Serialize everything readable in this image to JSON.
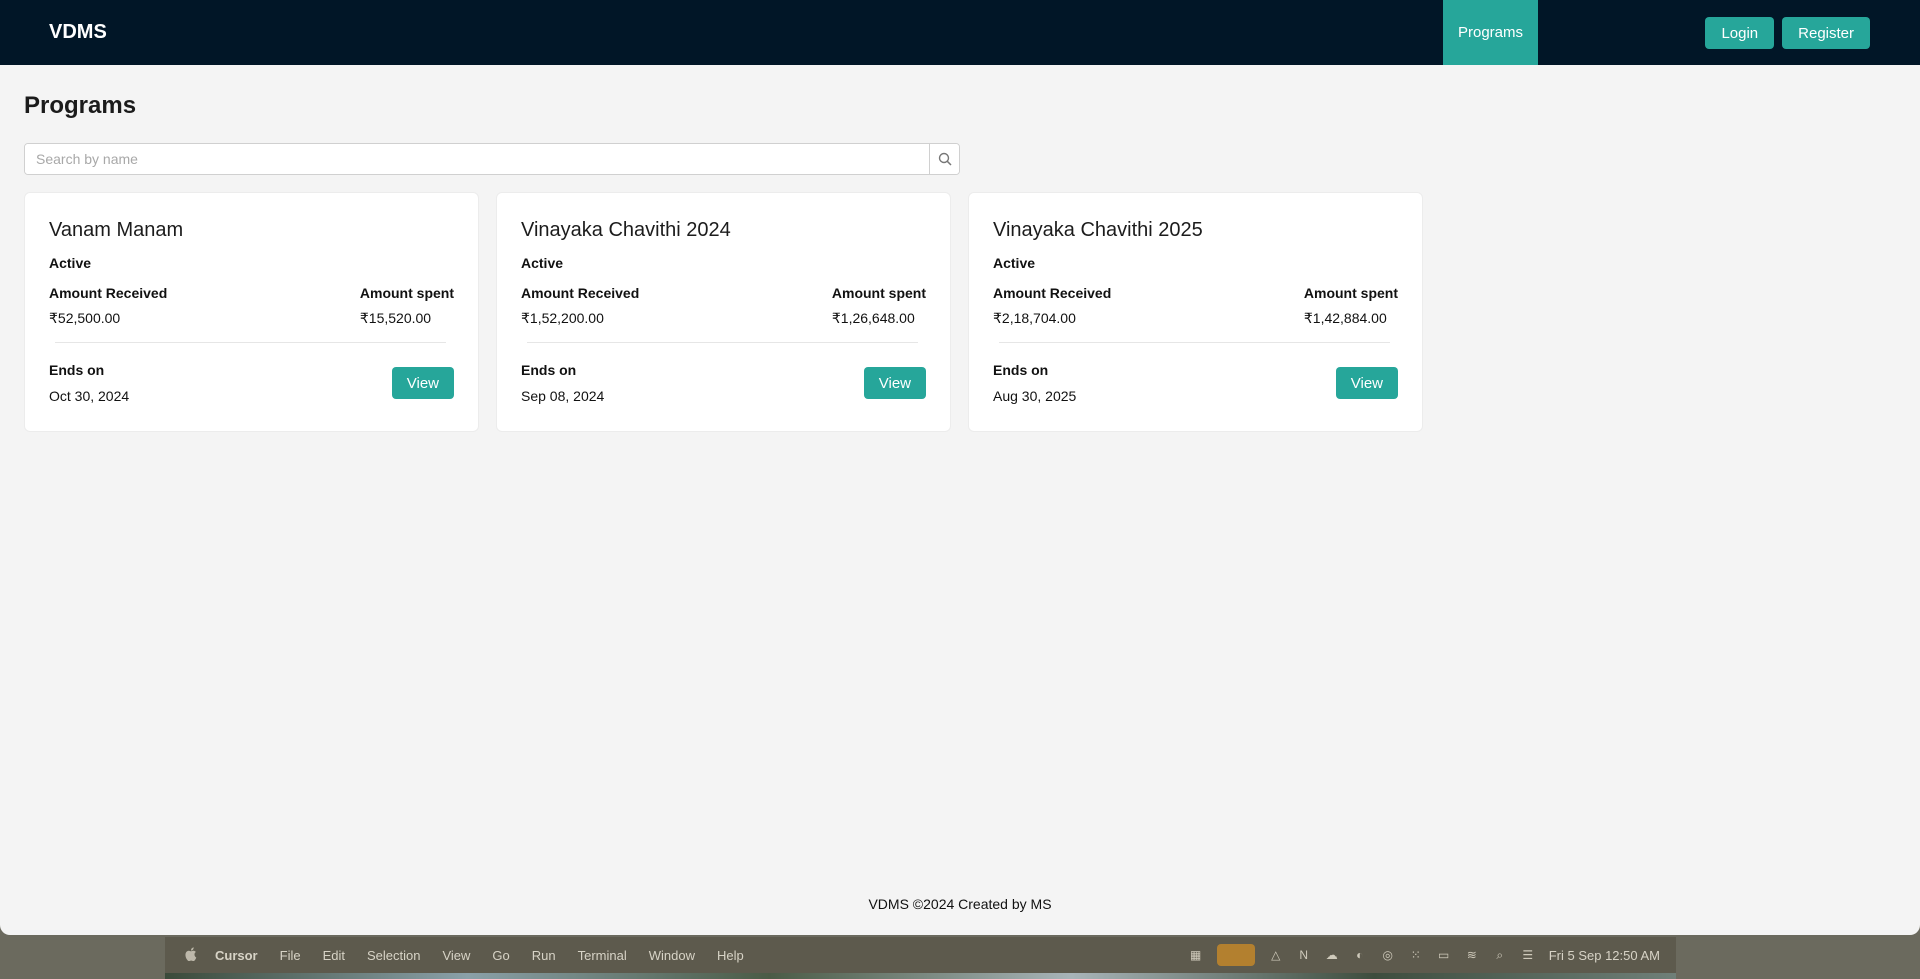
{
  "navbar": {
    "brand": "VDMS",
    "tab_programs": "Programs",
    "login_label": "Login",
    "register_label": "Register"
  },
  "page": {
    "title": "Programs",
    "search_placeholder": "Search by name"
  },
  "cards": [
    {
      "title": "Vanam Manam",
      "status": "Active",
      "received_label": "Amount Received",
      "received_value": "₹52,500.00",
      "spent_label": "Amount spent",
      "spent_value": "₹15,520.00",
      "ends_label": "Ends on",
      "ends_value": "Oct 30, 2024",
      "view_label": "View"
    },
    {
      "title": "Vinayaka Chavithi 2024",
      "status": "Active",
      "received_label": "Amount Received",
      "received_value": "₹1,52,200.00",
      "spent_label": "Amount spent",
      "spent_value": "₹1,26,648.00",
      "ends_label": "Ends on",
      "ends_value": "Sep 08, 2024",
      "view_label": "View"
    },
    {
      "title": "Vinayaka Chavithi 2025",
      "status": "Active",
      "received_label": "Amount Received",
      "received_value": "₹2,18,704.00",
      "spent_label": "Amount spent",
      "spent_value": "₹1,42,884.00",
      "ends_label": "Ends on",
      "ends_value": "Aug 30, 2025",
      "view_label": "View"
    }
  ],
  "footer": {
    "text": "VDMS ©2024 Created by MS"
  },
  "menubar": {
    "apple_icon": "apple-icon",
    "items": [
      "Cursor",
      "File",
      "Edit",
      "Selection",
      "View",
      "Go",
      "Run",
      "Terminal",
      "Window",
      "Help"
    ],
    "clock": "Fri 5 Sep  12:50 AM"
  },
  "colors": {
    "navbar_bg": "#011627",
    "accent": "#26a69a",
    "page_bg": "#f4f4f4"
  }
}
